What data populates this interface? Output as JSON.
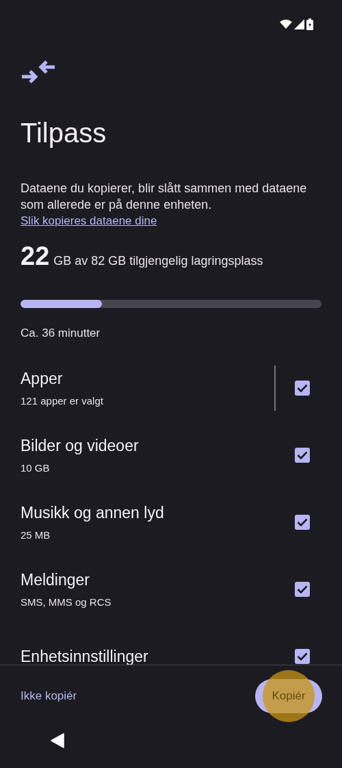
{
  "title": "Tilpass",
  "description": "Dataene du kopierer, blir slått sammen med dataene som allerede er på denne enheten.",
  "link": "Slik kopieres dataene dine",
  "storage": {
    "amount": "22",
    "text": "GB av 82 GB tilgjengelig lagringsplass",
    "level": 0.27
  },
  "estimate": "Ca. 36 minutter",
  "items": [
    {
      "title": "Apper",
      "subtitle": "121 apper er valgt",
      "checked": true,
      "split": true
    },
    {
      "title": "Bilder og videoer",
      "subtitle": "10 GB",
      "checked": true,
      "split": false
    },
    {
      "title": "Musikk og annen lyd",
      "subtitle": "25 MB",
      "checked": true,
      "split": false
    },
    {
      "title": "Meldinger",
      "subtitle": "SMS, MMS og RCS",
      "checked": true,
      "split": false
    },
    {
      "title": "Enhetsinnstillinger",
      "checked": true,
      "split": false
    }
  ],
  "secondary_button": "Ikke kopiér",
  "primary_button": {
    "label": "Kopiér",
    "pressed": true
  }
}
